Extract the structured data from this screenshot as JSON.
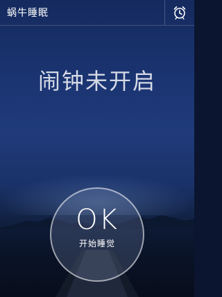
{
  "header": {
    "title": "蜗牛睡眠",
    "alarm_icon": "alarm-clock-icon"
  },
  "main": {
    "status": "闹钟未开启",
    "ok_label": "OK",
    "ok_sub": "开始睡觉"
  }
}
